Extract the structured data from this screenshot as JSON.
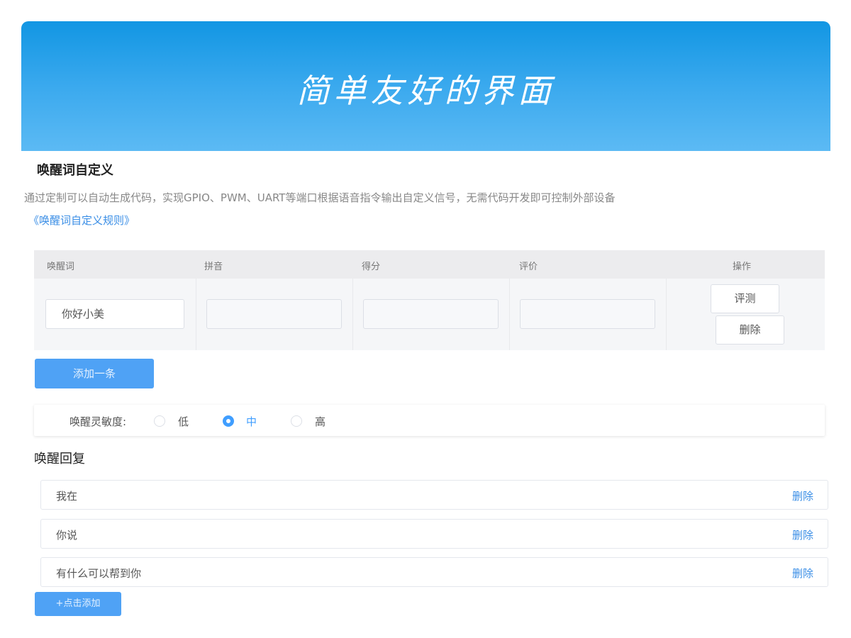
{
  "banner": {
    "title": "简单友好的界面"
  },
  "section": {
    "title": "唤醒词自定义",
    "description": "通过定制可以自动生成代码，实现GPIO、PWM、UART等端口根据语音指令输出自定义信号，无需代码开发即可控制外部设备",
    "rule_link": "《唤醒词自定义规则》"
  },
  "table": {
    "headers": [
      "唤醒词",
      "拼音",
      "得分",
      "评价",
      "操作"
    ],
    "row": {
      "wake_word": "你好小美",
      "pinyin": "",
      "score": "",
      "evaluation": "",
      "evaluate_button": "评测",
      "delete_button": "删除"
    }
  },
  "add_one_button": "添加一条",
  "sensitivity": {
    "label": "唤醒灵敏度:",
    "options": [
      "低",
      "中",
      "高"
    ],
    "selected": "中"
  },
  "reply": {
    "title": "唤醒回复",
    "items": [
      "我在",
      "你说",
      "有什么可以帮到你"
    ],
    "delete_label": "删除",
    "add_button": "+点击添加"
  },
  "colors": {
    "banner_top": "#1296e3",
    "banner_bottom": "#5cbaf4",
    "primary": "#409eff",
    "link": "#3a8ee6"
  }
}
